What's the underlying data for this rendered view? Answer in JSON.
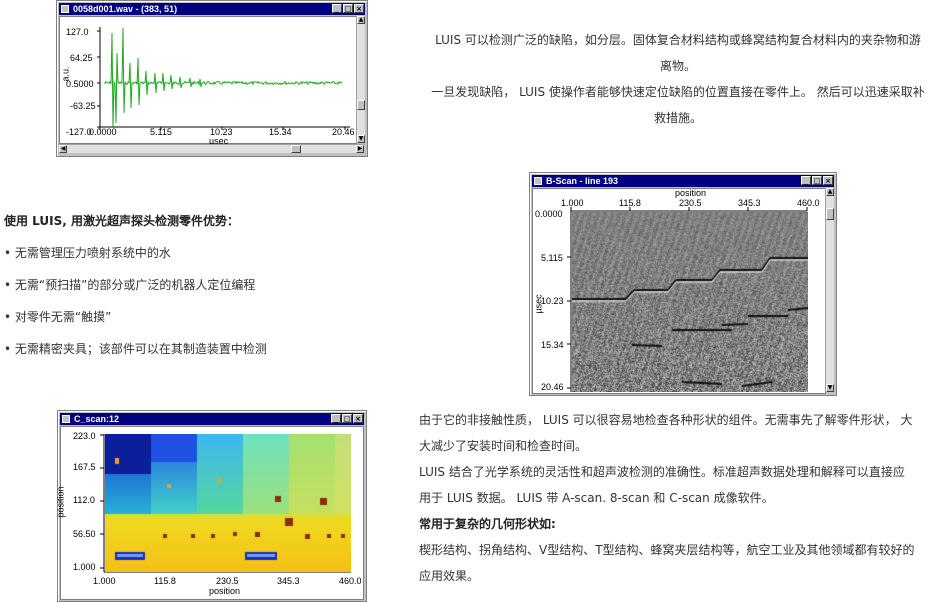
{
  "windows": {
    "ascan": {
      "title": "0058d001.wav - (383, 51)",
      "y_ticks": [
        "127.0",
        "64.25",
        "0.5000",
        "-63.25",
        "-127.0"
      ],
      "y_label": "a.u.",
      "x_ticks": [
        "0.0000",
        "5.115",
        "10.23",
        "15.34",
        "20.46"
      ],
      "x_label": "µsec",
      "signal_color": "#1faa1f"
    },
    "bscan": {
      "title": "B-Scan - line 193",
      "x_label": "position",
      "x_ticks": [
        "1.000",
        "115.8",
        "230.5",
        "345.3",
        "460.0"
      ],
      "y_label": "µsec",
      "y_ticks": [
        "0.0000",
        "5.115",
        "10.23",
        "15.34",
        "20.46"
      ]
    },
    "cscan": {
      "title": "C_scan:12",
      "y_label": "position",
      "y_ticks": [
        "223.0",
        "167.5",
        "112.0",
        "56.50",
        "1.000"
      ],
      "x_ticks": [
        "1.000",
        "115.8",
        "230.5",
        "345.3",
        "460.0"
      ],
      "x_label": "position"
    }
  },
  "buttons": {
    "minimize": "_",
    "maximize": "□",
    "close": "×"
  },
  "scroll": {
    "up": "▲",
    "down": "▼",
    "left": "◀",
    "right": "▶"
  },
  "text": {
    "p1a": "LUIS 可以检测广泛的缺陷，如分层。固体复合材料结构或蜂窝结构复合材料内的夹杂物和游",
    "p1b": "离物。",
    "p2a": "一旦发现缺陷， LUIS 使操作者能够快速定位缺陷的位置直接在零件上。 然后可以迅速采取补",
    "p2b": "救措施。",
    "adv_heading": "使用 LUIS, 用激光超声探头检测零件优势：",
    "adv_items": [
      "• 无需管理压力喷射系统中的水",
      "• 无需“预扫描”的部分或广泛的机器人定位编程",
      "• 对零件无需“触摸”",
      "• 无需精密夹具；该部件可以在其制造装置中检测"
    ],
    "p3a": "由于它的非接触性质， LUIS 可以很容易地检查各种形状的组件。无需事先了解零件形状， 大",
    "p3b": "大减少了安装时间和检查时间。",
    "p4a": "LUIS 结合了光学系统的灵活性和超声波检测的准确性。标准超声数据处理和解释可以直接应",
    "p4b": "用于 LUIS 数据。 LUIS 带 A-scan. 8-scan 和 C-scan 成像软件。",
    "geo_heading": "常用于复杂的几何形状如:",
    "p5a": "楔形结构、拐角结构、V型结构、T型结构、蜂窝夹层结构等，航空工业及其他领域都有较好的",
    "p5b": "应用效果。"
  }
}
